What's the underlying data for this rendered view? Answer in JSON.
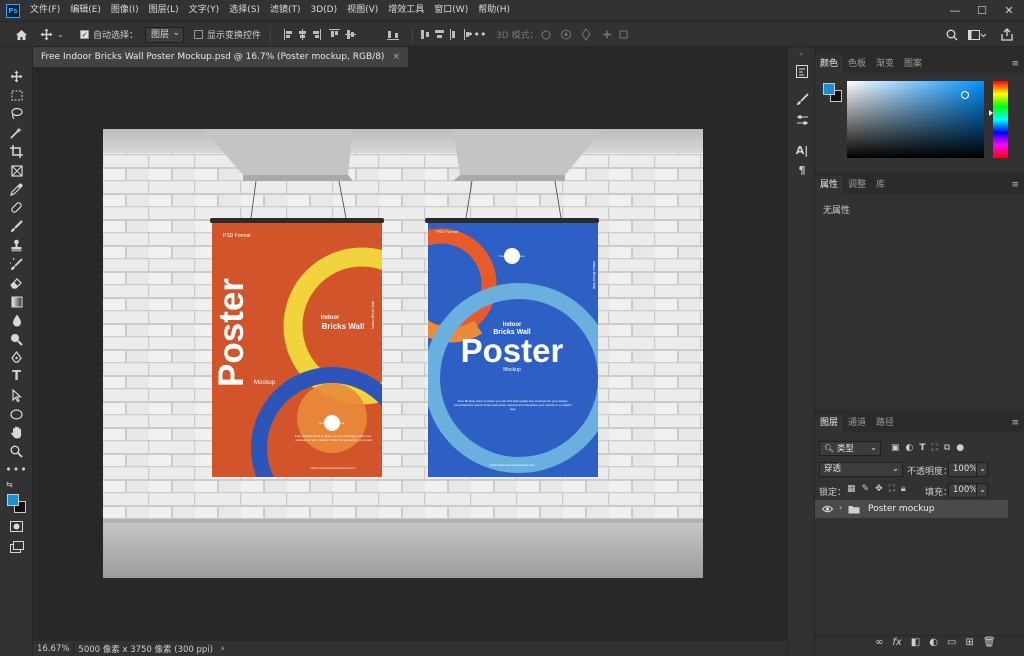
{
  "app": {
    "logo_text": "Ps"
  },
  "menu": [
    "文件(F)",
    "编辑(E)",
    "图像(I)",
    "图层(L)",
    "文字(Y)",
    "选择(S)",
    "滤镜(T)",
    "3D(D)",
    "视图(V)",
    "增效工具",
    "窗口(W)",
    "帮助(H)"
  ],
  "window_controls": {
    "minimize": "—",
    "maximize": "☐",
    "close": "✕"
  },
  "options": {
    "auto_select_label": "自动选择：",
    "auto_select_checked": true,
    "auto_select_value": "图层",
    "show_transform_label": "显示变换控件",
    "show_transform_checked": false,
    "more": "•••",
    "mode_3d_label": "3D 模式："
  },
  "document": {
    "tab_title": "Free Indoor Bricks Wall Poster Mockup.psd @ 16.7% (Poster mockup, RGB/8)",
    "close": "×"
  },
  "poster_left": {
    "format": "PSD Format",
    "title": "Poster",
    "sub": "Mockup",
    "side1": "Indoor",
    "side2": "Bricks Wall",
    "side3": "Indoor Bricks Wall",
    "logo": "Free Mockup Zone",
    "body": "Free Mockup Zone is where you can find high quality free mockups for your design. Perfect for presenting your work.",
    "url": "https://www.freemockupzone.com"
  },
  "poster_right": {
    "format": "PSD Format",
    "logo": "Free Mockup Zone",
    "sub1": "Indoor",
    "sub2": "Bricks Wall",
    "title": "Poster",
    "sub": "Mockup",
    "side": "Indoor Bricks Wall",
    "body": "Free Mockup Zone is where you can find high quality free mockups for your design. Download this indoor bricks wall poster mockup and showcase your artwork in a realistic way.",
    "url": "https://www.freemockupzone.com"
  },
  "status": {
    "zoom": "16.67%",
    "info": "5000 像素 x 3750 像素 (300 ppi)",
    "arrow": "›"
  },
  "color_panel": {
    "tabs": [
      "颜色",
      "色板",
      "渐变",
      "图案"
    ],
    "active": "颜色",
    "fg_color": "#1a8fd6",
    "bg_color": "#111111"
  },
  "properties_panel": {
    "tabs": [
      "属性",
      "调整",
      "库"
    ],
    "active": "属性",
    "empty_text": "无属性"
  },
  "layers_panel": {
    "tabs": [
      "图层",
      "通道",
      "路径"
    ],
    "active": "图层",
    "filter_label": "类型",
    "blend_mode": "穿透",
    "opacity_label": "不透明度：",
    "opacity_value": "100%",
    "lock_label": "锁定：",
    "fill_label": "填充：",
    "fill_value": "100%",
    "layers": [
      {
        "name": "Poster mockup",
        "visible": true,
        "type": "group"
      }
    ]
  },
  "layer_footer_icons": [
    "link-icon",
    "fx-icon",
    "mask-icon",
    "adjustment-icon",
    "group-icon",
    "new-layer-icon",
    "trash-icon"
  ],
  "footer_glyphs": {
    "link": "∞",
    "fx": "fx",
    "mask": "◧",
    "adjust": "◐",
    "group": "▭",
    "new": "⊞",
    "trash": "🗑"
  }
}
